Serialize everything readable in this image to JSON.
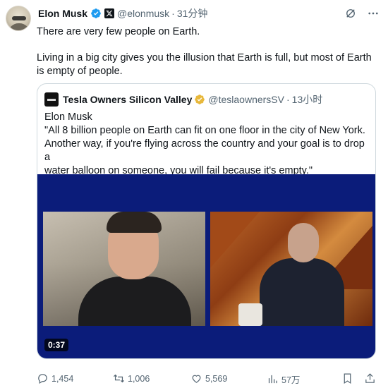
{
  "author": {
    "name": "Elon Musk",
    "handle": "@elonmusk",
    "separator": "·",
    "time": "31分钟",
    "badge_color": "#1d9bf0"
  },
  "header_icons": [
    "grok-icon",
    "more-icon"
  ],
  "tweet": {
    "line1": "There are very few people on Earth.",
    "line2": "Living in a big city gives you the illusion that Earth is full, but most of Earth is empty of people."
  },
  "quoted": {
    "name": "Tesla Owners Silicon Valley",
    "handle": "@teslaownersSV",
    "separator": "·",
    "time": "13小时",
    "badge_color": "#e8b83b",
    "speaker": "Elon Musk",
    "quote_lines": [
      "\"All 8 billion people on Earth can fit on one floor in the city of New York.",
      "Another way, if you're flying across the country and your goal is to drop a",
      "water balloon on someone, you will fail because it's empty.\""
    ],
    "video_duration": "0:37"
  },
  "actions": {
    "replies": "1,454",
    "reposts": "1,006",
    "likes": "5,569",
    "views": "57万"
  }
}
